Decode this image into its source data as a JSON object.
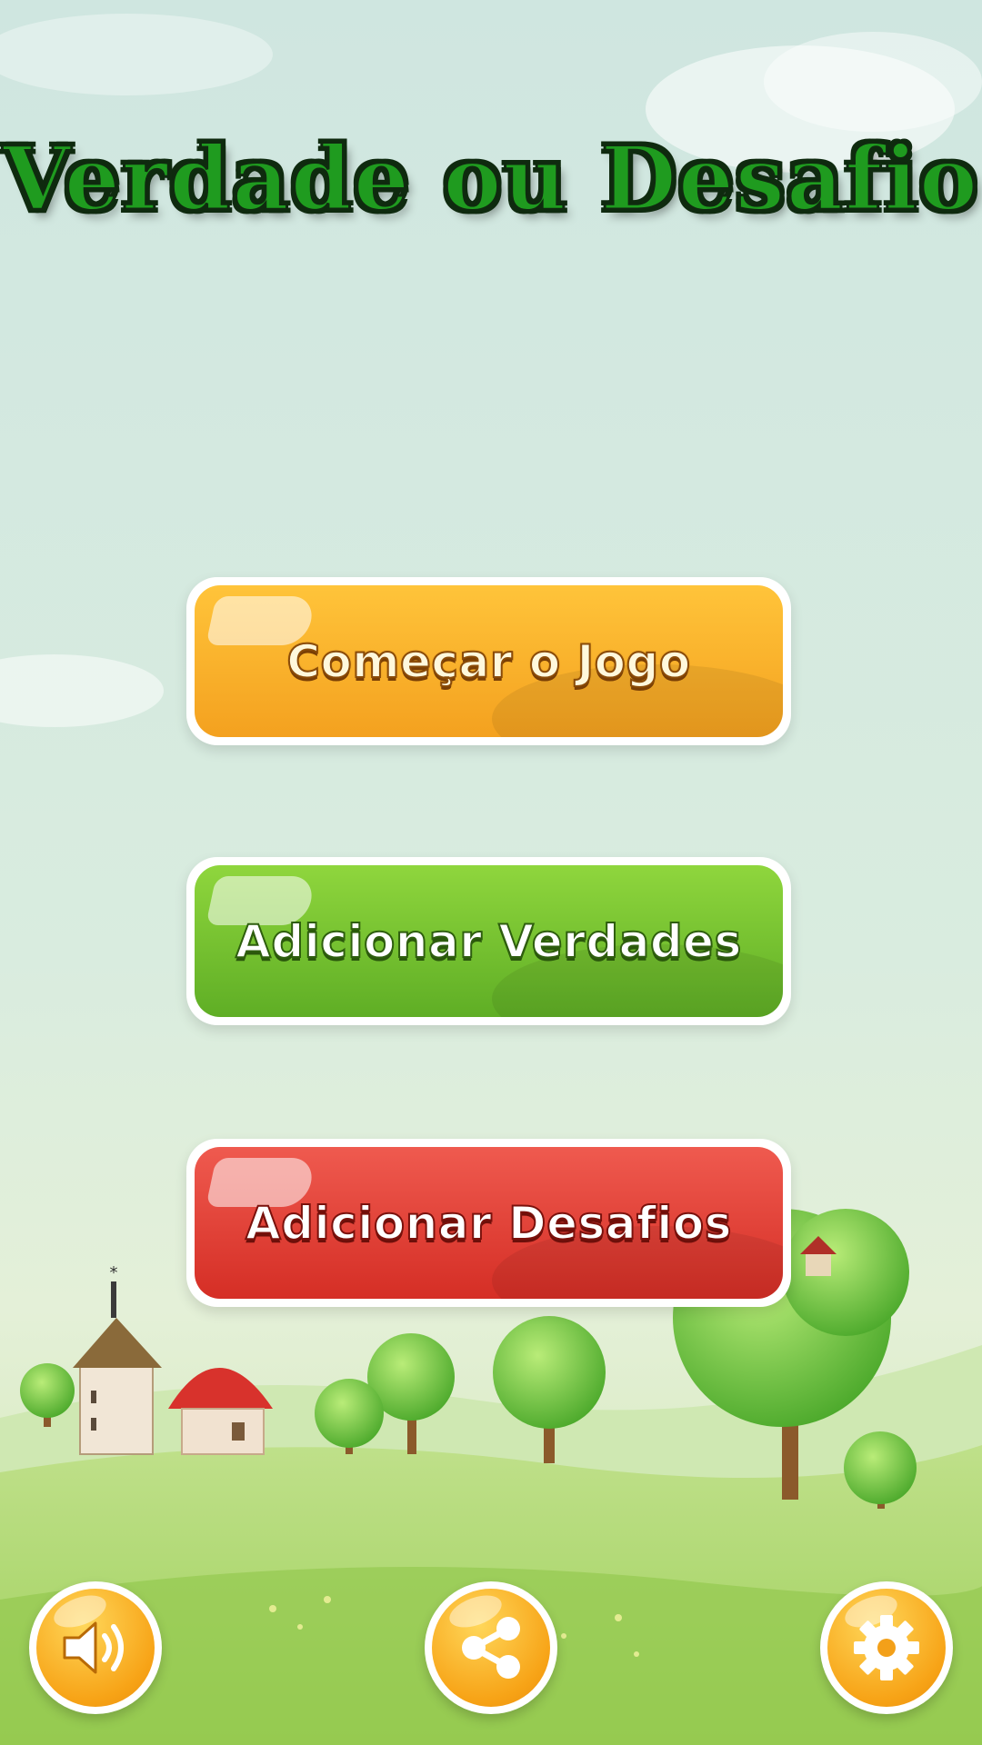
{
  "title": "Verdade ou Desafio",
  "menu": {
    "start_label": "Começar o Jogo",
    "add_truths_label": "Adicionar Verdades",
    "add_dares_label": "Adicionar Desafios"
  },
  "bottom_bar": {
    "sound_icon": "speaker-icon",
    "share_icon": "share-icon",
    "settings_icon": "gear-icon"
  },
  "colors": {
    "title": "#1f9b1f",
    "start_button": "#f9b02a",
    "truths_button": "#74c12f",
    "dares_button": "#e0413a",
    "round_buttons": "#f7a316"
  }
}
